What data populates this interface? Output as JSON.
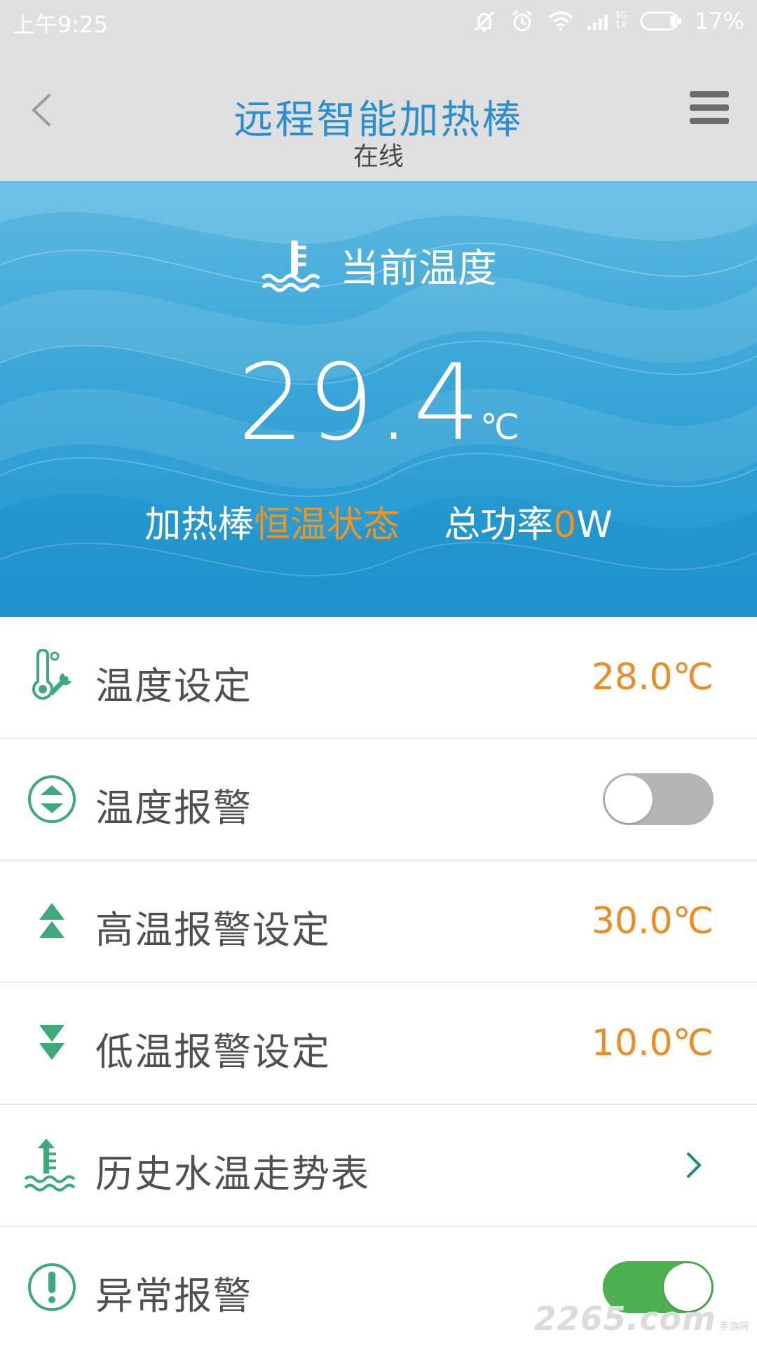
{
  "status_bar": {
    "time": "上午9:25",
    "network_top": "4G",
    "network_bottom": "1X",
    "battery_percent": "17%",
    "icons": [
      "mute-vibrate-icon",
      "alarm-icon",
      "wifi-icon",
      "signal-icon",
      "battery-icon"
    ]
  },
  "header": {
    "title": "远程智能加热棒",
    "subtitle": "在线",
    "back_icon": "chevron-left-icon",
    "menu_icon": "hamburger-menu-icon"
  },
  "hero": {
    "label": "当前温度",
    "temperature": "29.4",
    "unit": "℃",
    "status_prefix": "加热棒",
    "status_value": "恒温状态",
    "power_prefix": "总功率",
    "power_value": "0",
    "power_unit": "W"
  },
  "settings": {
    "temp_setting": {
      "label": "温度设定",
      "value": "28.0℃"
    },
    "temp_alarm": {
      "label": "温度报警",
      "enabled": false
    },
    "high_alarm": {
      "label": "高温报警设定",
      "value": "30.0℃"
    },
    "low_alarm": {
      "label": "低温报警设定",
      "value": "10.0℃"
    },
    "history": {
      "label": "历史水温走势表"
    },
    "abnormal_alarm": {
      "label": "异常报警",
      "enabled": true
    }
  },
  "watermark": {
    "main": "2265.com",
    "side": "手游网"
  },
  "colors": {
    "title_blue": "#2a8fd0",
    "accent_orange": "#ee8c22",
    "icon_green": "#3daa7c",
    "toggle_on": "#4caf50",
    "toggle_off": "#b5b5b5"
  }
}
